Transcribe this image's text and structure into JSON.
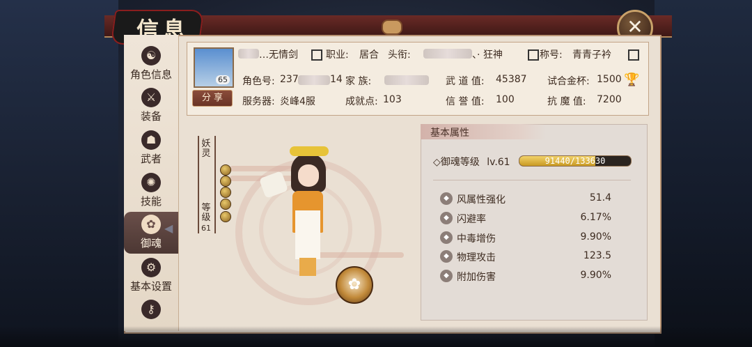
{
  "window": {
    "title": "信息",
    "close_label": "✕"
  },
  "sidebar": {
    "items": [
      {
        "label": "角色信息",
        "icon": "character-icon"
      },
      {
        "label": "装备",
        "icon": "swords-icon"
      },
      {
        "label": "武者",
        "icon": "warrior-icon"
      },
      {
        "label": "技能",
        "icon": "skill-icon"
      },
      {
        "label": "御魂",
        "icon": "spirit-icon"
      },
      {
        "label": "基本设置",
        "icon": "gear-icon"
      }
    ],
    "active_index": 4
  },
  "profile": {
    "name": "…无情剑",
    "job_label": "职业:",
    "job_value": "居合",
    "title_label": "头衔:",
    "title_suffix": "、· 狂神",
    "nickname_label": "称号:",
    "nickname_value": "青青子衿",
    "avatar_level": "65",
    "share_label": "分 享",
    "role_id_label": "角色号:",
    "role_id_start": "237",
    "role_id_end": "14",
    "clan_label": "家 族:",
    "wudao_label": "武 道 值:",
    "wudao_value": "45387",
    "cup_label": "试合金杯:",
    "cup_value": "1500",
    "server_label": "服务器:",
    "server_value": "炎峰4服",
    "achievement_label": "成就点:",
    "achievement_value": "103",
    "credit_label": "信 誉 值:",
    "credit_value": "100",
    "demon_label": "抗 魔 值:",
    "demon_value": "7200"
  },
  "preview": {
    "vertical_top": "妖灵",
    "vertical_bottom": "等级",
    "vertical_level": "61"
  },
  "attributes": {
    "header": "基本属性",
    "yuhun_label": "◇御魂等级",
    "yuhun_level": "lv.61",
    "exp_text": "91440/133630",
    "exp_fraction": 0.684,
    "stats": [
      {
        "label": "风属性强化",
        "value": "51.4"
      },
      {
        "label": "闪避率",
        "value": "6.17%"
      },
      {
        "label": "中毒增伤",
        "value": "9.90%"
      },
      {
        "label": "物理攻击",
        "value": "123.5"
      },
      {
        "label": "附加伤害",
        "value": "9.90%"
      }
    ]
  }
}
